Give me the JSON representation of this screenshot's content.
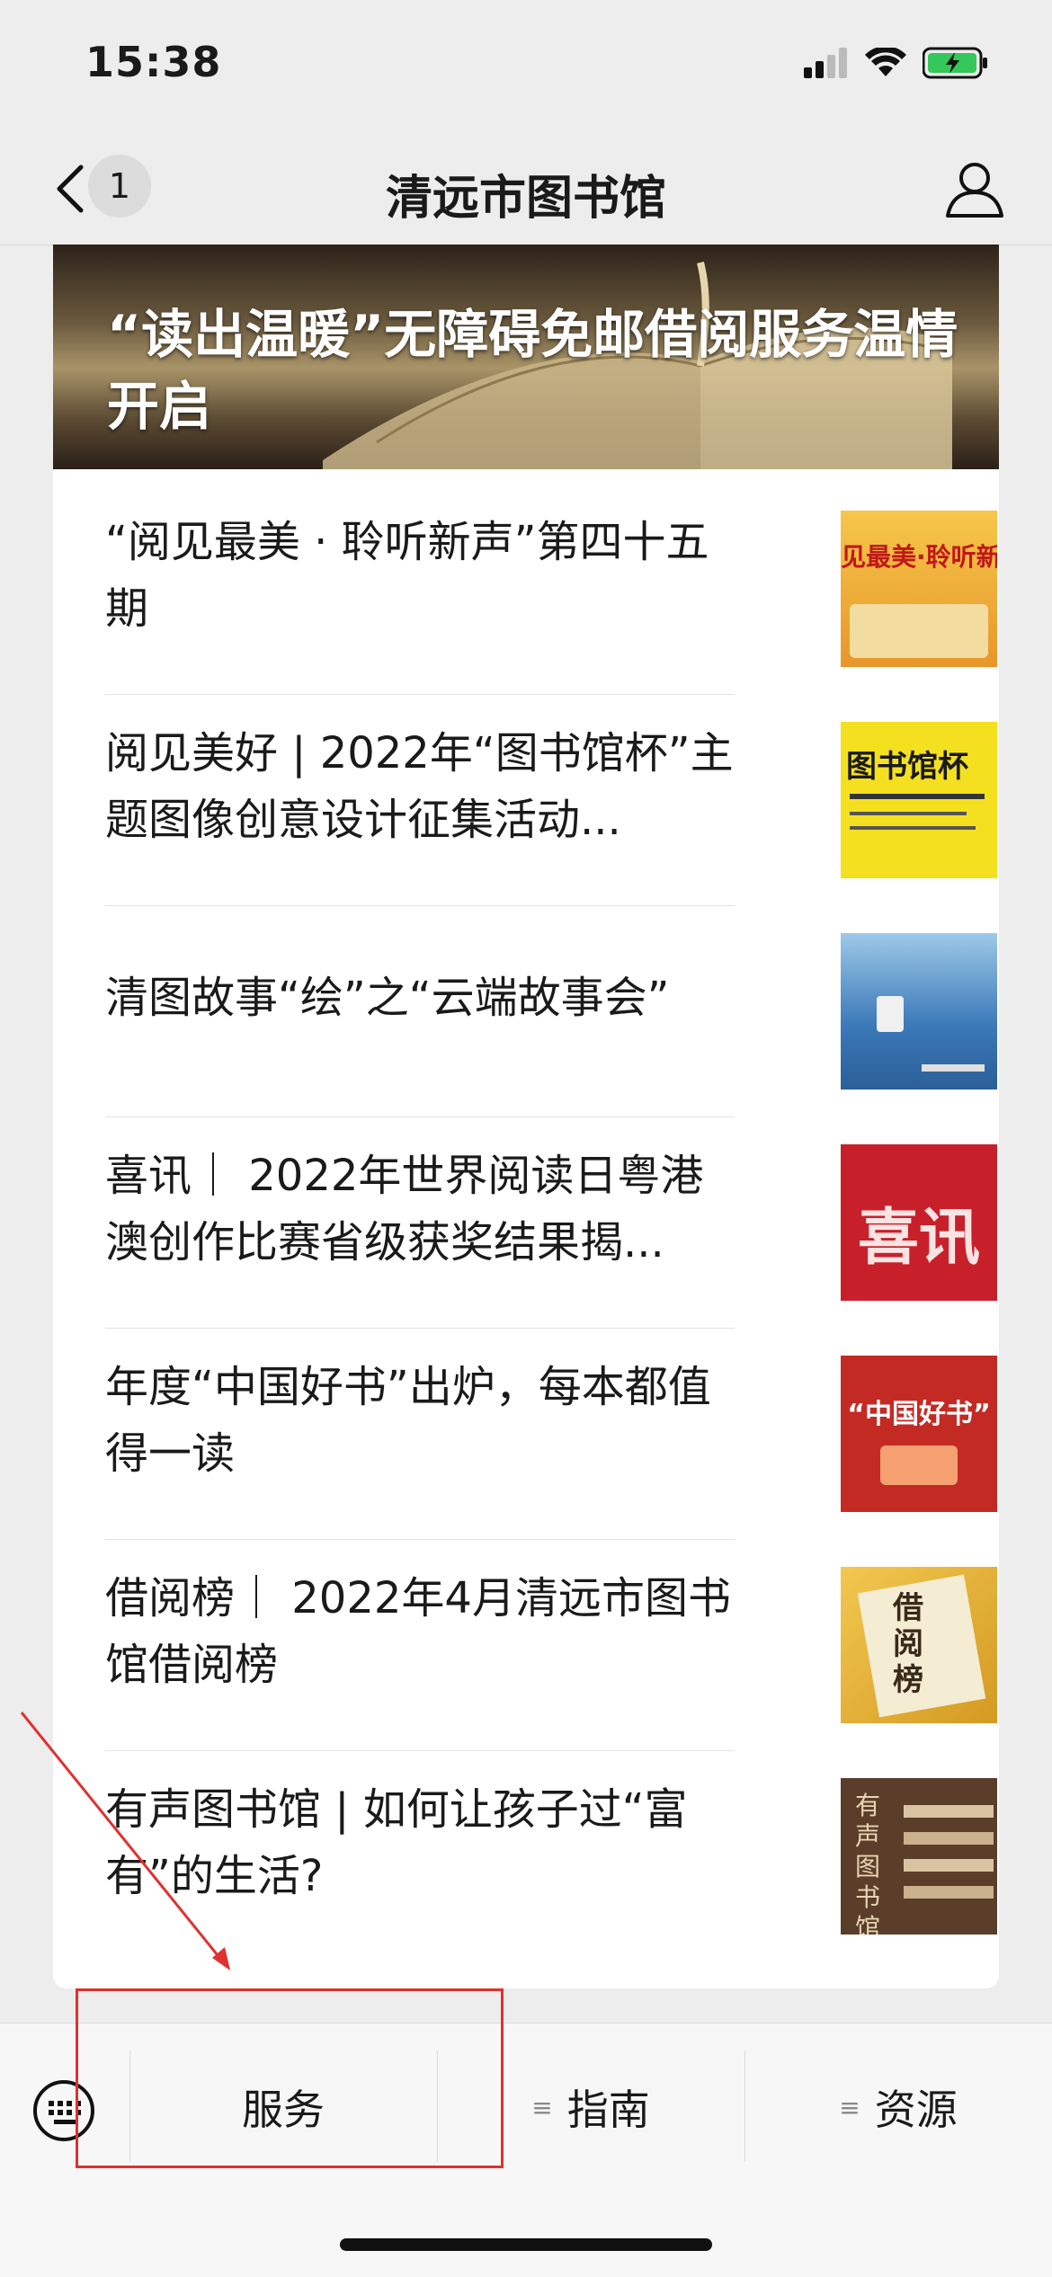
{
  "status_bar": {
    "time": "15:38"
  },
  "nav": {
    "back_count": "1",
    "title": "清远市图书馆"
  },
  "banner": {
    "title": "“读出温暖”无障碍免邮借阅服务温情开启"
  },
  "articles": [
    {
      "title": "“阅见最美 · 聆听新声”第四十五期",
      "thumb_text": "见最美·聆听新",
      "thumb_color": "#f0b23a"
    },
    {
      "title": "阅见美好 | 2022年“图书馆杯”主题图像创意设计征集活动...",
      "thumb_text": "图书馆杯",
      "thumb_color": "#f5e020"
    },
    {
      "title": "清图故事“绘”之“云端故事会”",
      "thumb_text": "",
      "thumb_color": "#3a78b8"
    },
    {
      "title": "喜讯｜ 2022年世界阅读日粤港澳创作比赛省级获奖结果揭...",
      "thumb_text": "喜讯",
      "thumb_color": "#c8202a"
    },
    {
      "title": "年度“中国好书”出炉，每本都值得一读",
      "thumb_text": "“中国好书”",
      "thumb_color": "#c42a24"
    },
    {
      "title": "借阅榜｜ 2022年4月清远市图书馆借阅榜",
      "thumb_text": "借阅榜",
      "thumb_color": "#e8b430"
    },
    {
      "title": "有声图书馆 | 如何让孩子过“富有”的生活?",
      "thumb_text": "有声图书馆",
      "thumb_color": "#5a3e2a"
    }
  ],
  "bottom_menu": [
    {
      "label": "服务"
    },
    {
      "label": "指南"
    },
    {
      "label": "资源"
    }
  ],
  "annotation_color": "#e03030"
}
